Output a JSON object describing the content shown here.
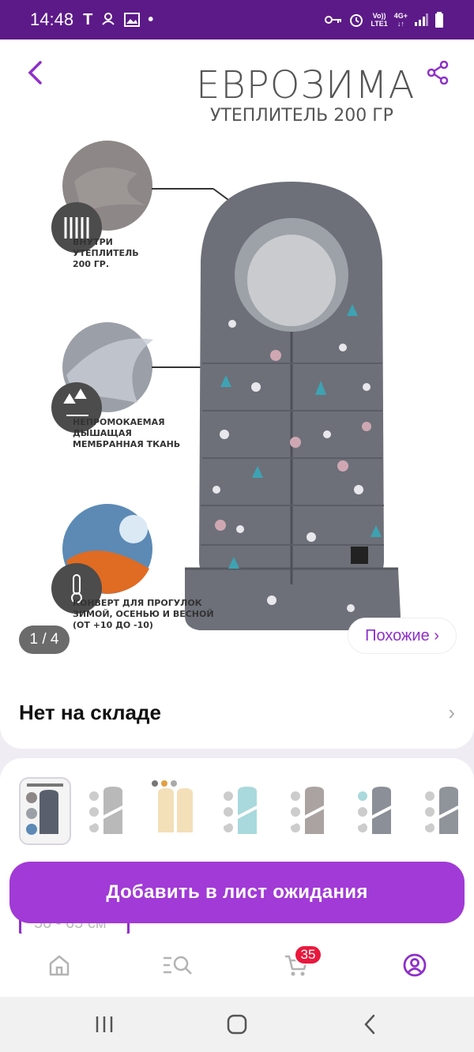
{
  "status_bar": {
    "time": "14:48",
    "left_icons": [
      "T",
      "weather-icon",
      "image-icon",
      "•"
    ],
    "net_top": "Vo))",
    "net_bottom": "LTE1",
    "net_type": "4G+"
  },
  "product_image": {
    "title": "ЕВРОЗИМА",
    "subtitle": "УТЕПЛИТЕЛЬ 200 ГР",
    "features": [
      "ВНУТРИ\nУТЕПЛИТЕЛЬ\n200 ГР.",
      "НЕПРОМОКАЕМАЯ\nДЫШАЩАЯ\nМЕМБРАННАЯ ТКАНЬ",
      "КОНВЕРТ ДЛЯ ПРОГУЛОК\nЗИМОЙ, ОСЕНЬЮ И ВЕСНОЙ\n(ОТ +10 ДО -10)"
    ]
  },
  "gallery": {
    "counter": "1 / 4",
    "similar_label": "Похожие ›"
  },
  "stock": {
    "label": "Нет на складе",
    "chevron": "›"
  },
  "thumbnail_colors": [
    "#5a5f6e",
    "#b9b9b9",
    "#f3dfb8",
    "#a9d9dc",
    "#aaa3a1",
    "#8a8f98",
    "#8f949b"
  ],
  "size_chip": "50 - 65 см",
  "waitlist_button": "Добавить в лист ожидания",
  "cart_count": "35",
  "colors": {
    "accent": "#a13ad6",
    "status_bar": "#5c1a88",
    "badge": "#e8193d"
  }
}
